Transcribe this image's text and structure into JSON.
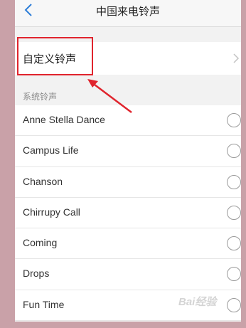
{
  "header": {
    "title": "中国来电铃声",
    "back_icon": "chevron-left-icon"
  },
  "custom": {
    "label": "自定义铃声",
    "chevron_icon": "chevron-right-icon"
  },
  "section": {
    "label": "系统铃声"
  },
  "ringtones": [
    {
      "name": "Anne Stella Dance"
    },
    {
      "name": "Campus Life"
    },
    {
      "name": "Chanson"
    },
    {
      "name": "Chirrupy Call"
    },
    {
      "name": "Coming"
    },
    {
      "name": "Drops"
    },
    {
      "name": "Fun Time"
    }
  ],
  "watermark": "Bai经验",
  "colors": {
    "accent": "#2f7fd8",
    "highlight": "#e0242d"
  }
}
